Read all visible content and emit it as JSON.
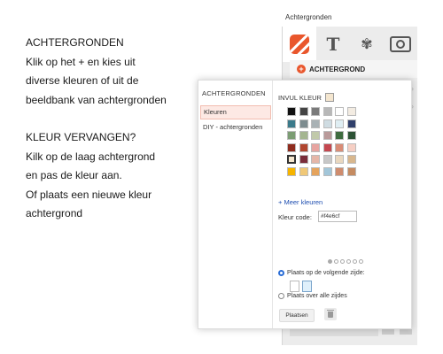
{
  "instructions": {
    "title": "ACHTERGRONDEN",
    "lines": [
      "Klik op het + en kies uit",
      "diverse kleuren of uit de",
      "beeldbank van achtergronden"
    ],
    "title2": "KLEUR VERVANGEN?",
    "lines2": [
      "Kilk op de laag achtergrond",
      "en pas de kleur aan.",
      "Of plaats een nieuwe kleur",
      "achtergrond"
    ]
  },
  "panel": {
    "title": "Achtergronden",
    "toolbar_icons": [
      "background-icon",
      "text-icon",
      "leaf-icon",
      "camera-icon"
    ],
    "section_header": "ACHTERGROND"
  },
  "popup": {
    "side_title": "ACHTERGRONDEN",
    "side_items": [
      "Kleuren",
      "DIY - achtergronden"
    ],
    "fill_label": "INVUL KLEUR",
    "fill_color": "#f4e6cf",
    "swatches": [
      [
        "#111111",
        "#444444",
        "#7a7a7a",
        "#b8b8b8",
        "#ffffff",
        "#f3ece2"
      ],
      [
        "#3b7a8a",
        "#7d8c8f",
        "#a9b2b5",
        "#cfdce2",
        "#dfeef3",
        "#2f3f6b"
      ],
      [
        "#7c9d74",
        "#a4b590",
        "#c1c9aa",
        "#b99a9a",
        "#3e6b3f",
        "#2d5235"
      ],
      [
        "#8e2c1e",
        "#b1462f",
        "#e7a4a0",
        "#c4474f",
        "#d98c76",
        "#f6cfc4"
      ],
      [
        "#f4e6cf",
        "#7a2d3a",
        "#e5b6a8",
        "#c7c7c7",
        "#e9d8c0",
        "#d8b78d"
      ],
      [
        "#f6b400",
        "#f0c877",
        "#e5a35c",
        "#a2c6d9",
        "#cf8c6e",
        "#c58b61"
      ]
    ],
    "meer_link": "+ Meer kleuren",
    "code_label": "Kleur code:",
    "code_value": "#f4e6cf",
    "radio1": "Plaats op de volgende zijde:",
    "radio2": "Plaats over alle zijdes",
    "place_button": "Plaatsen"
  }
}
